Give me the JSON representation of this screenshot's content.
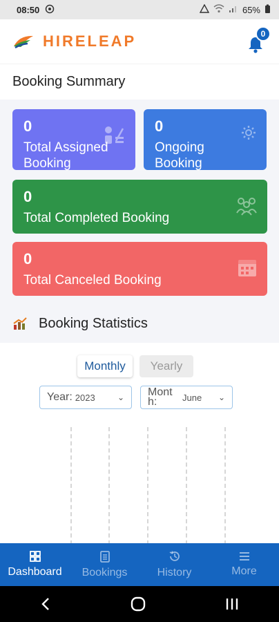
{
  "status_bar": {
    "time": "08:50",
    "battery": "65%"
  },
  "header": {
    "app_name": "HIRELEAP",
    "notification_count": "0"
  },
  "booking_summary": {
    "title": "Booking Summary",
    "cards": {
      "assigned": {
        "count": "0",
        "label": "Total Assigned Booking",
        "color": "#6f73f2"
      },
      "ongoing": {
        "count": "0",
        "label": "Ongoing Booking",
        "color": "#3d7be0"
      },
      "completed": {
        "count": "0",
        "label": "Total Completed Booking",
        "color": "#2e9448"
      },
      "canceled": {
        "count": "0",
        "label": "Total Canceled Booking",
        "color": "#f26666"
      }
    }
  },
  "booking_statistics": {
    "title": "Booking Statistics",
    "tabs": {
      "monthly": "Monthly",
      "yearly": "Yearly"
    },
    "year_select": {
      "label": "Year:",
      "value": "2023"
    },
    "month_select": {
      "label": "Mont h:",
      "value": "June"
    }
  },
  "bottom_nav": {
    "dashboard": "Dashboard",
    "bookings": "Bookings",
    "history": "History",
    "more": "More"
  },
  "colors": {
    "brand_orange": "#f07a2a",
    "primary_blue": "#1565c0"
  }
}
